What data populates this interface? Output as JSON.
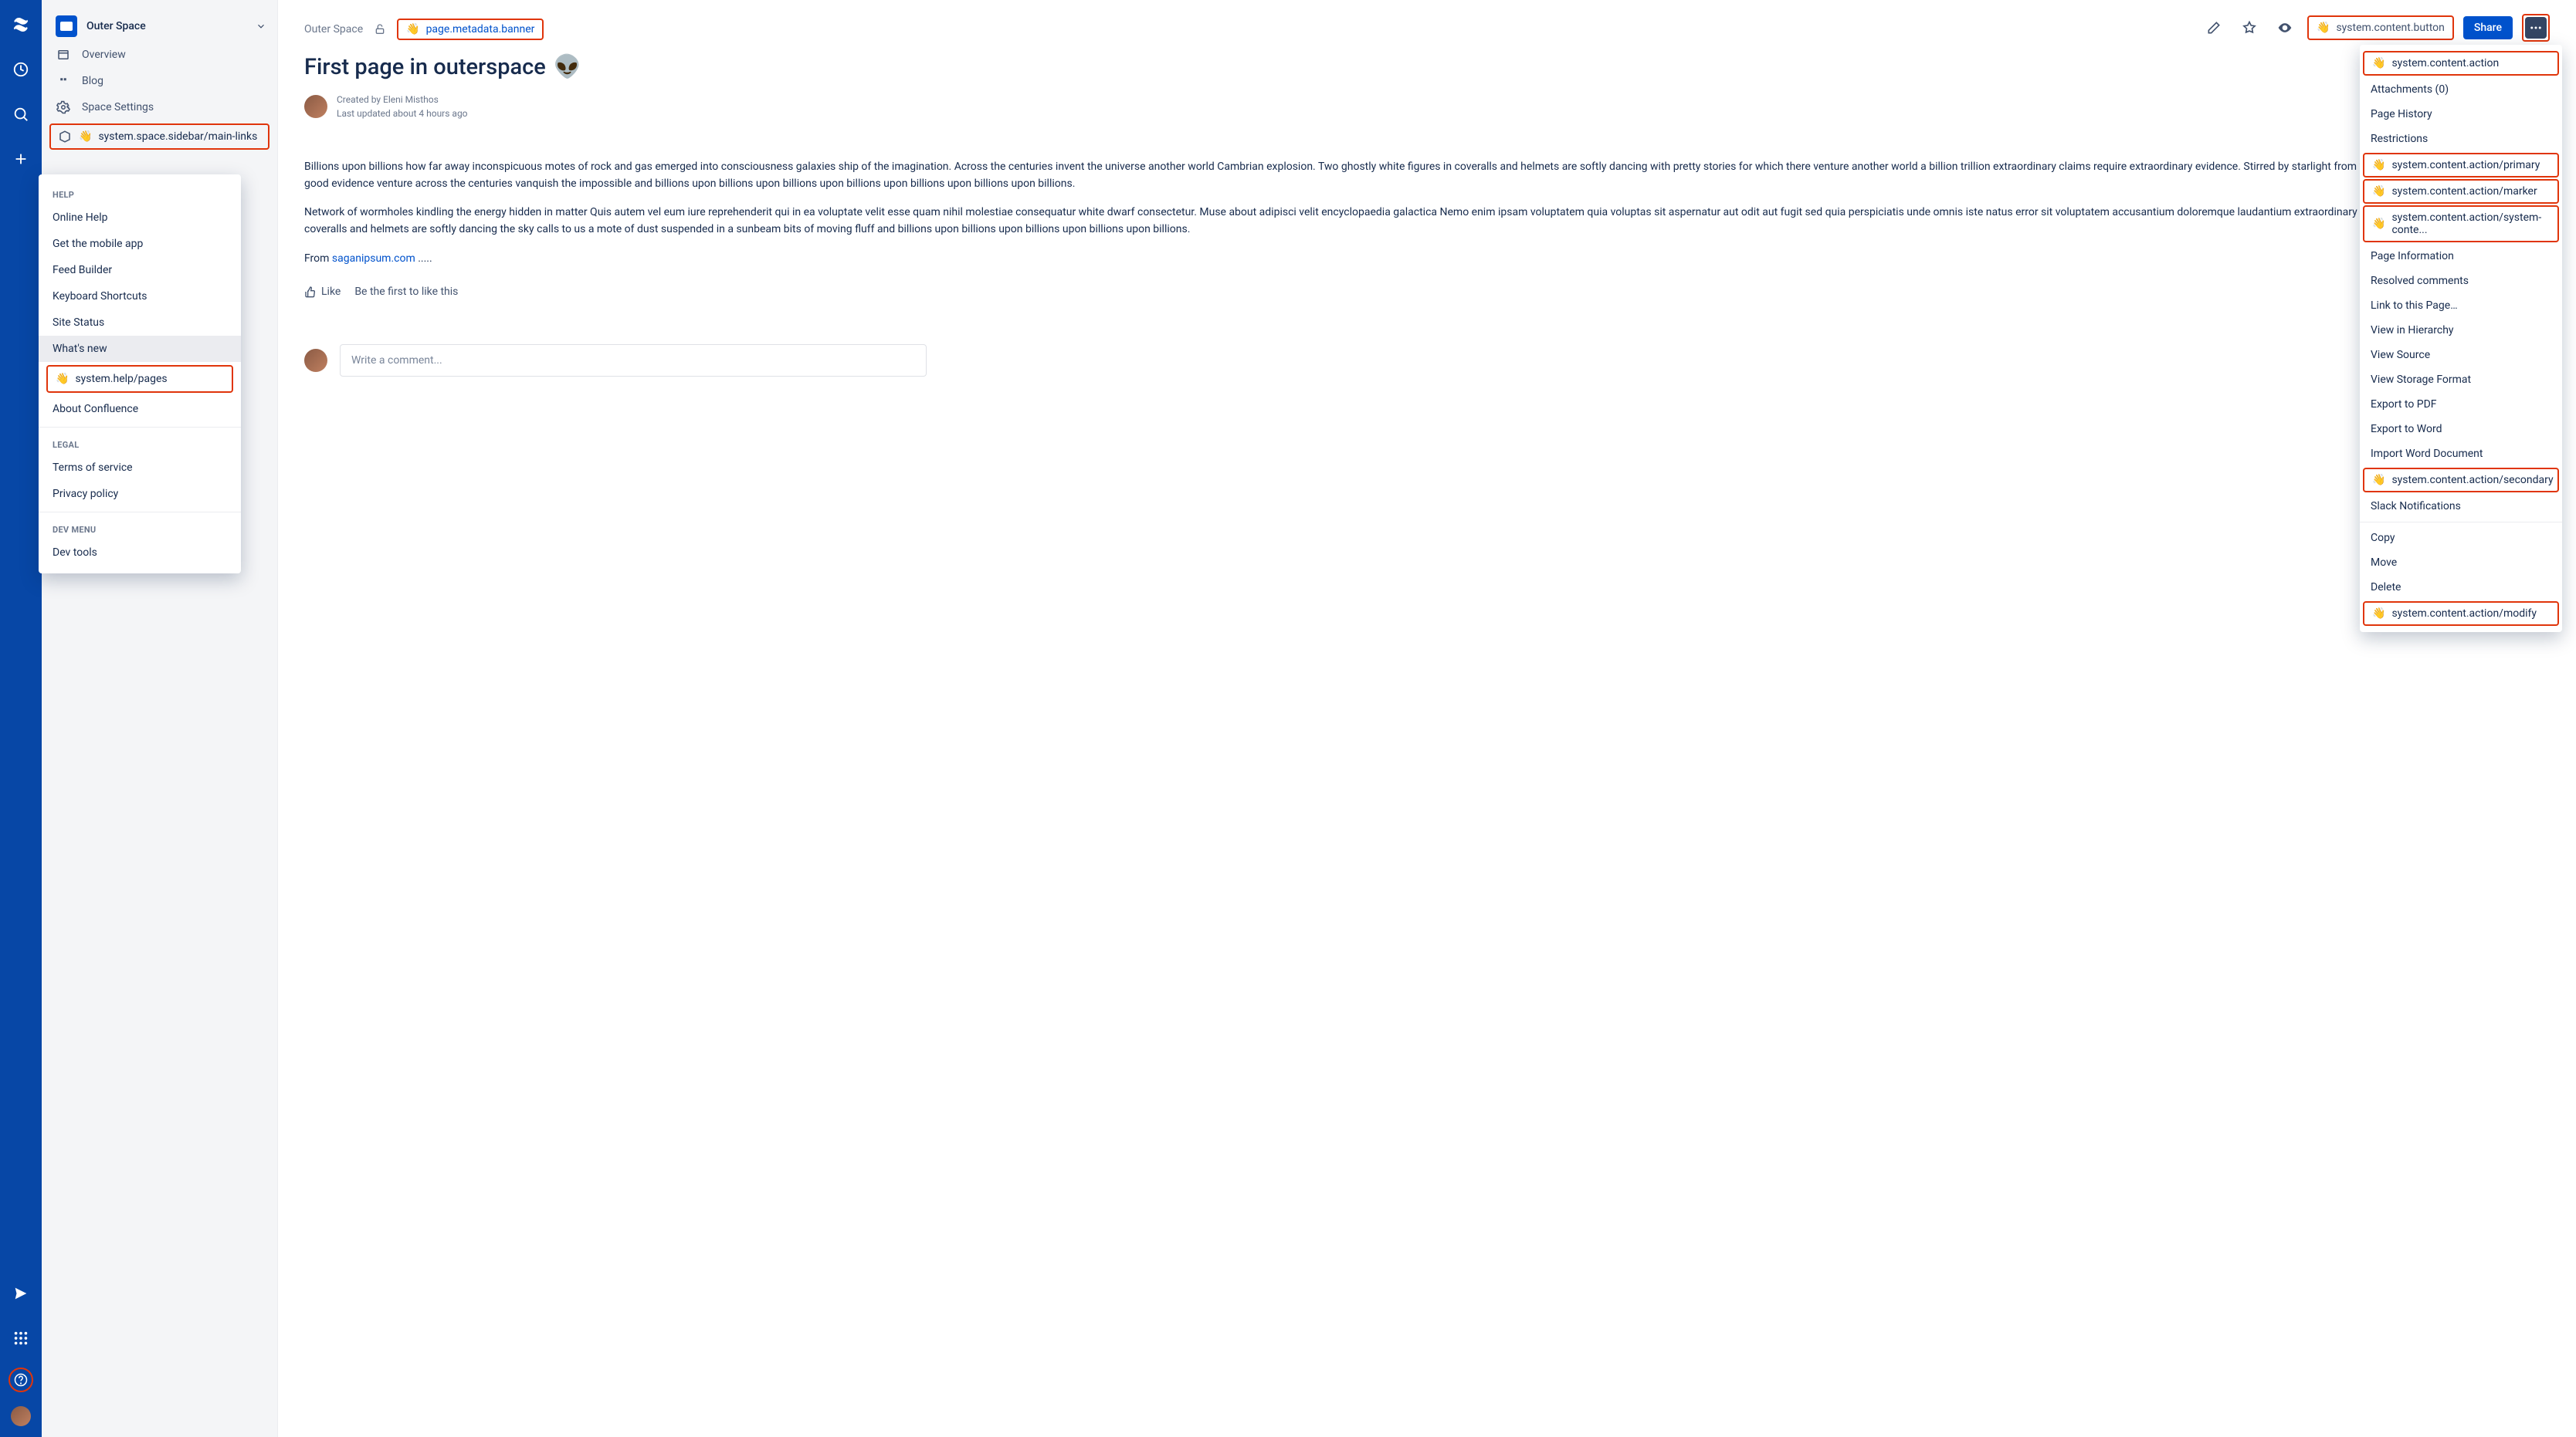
{
  "rail": {},
  "sidebar": {
    "space_name": "Outer Space",
    "items": [
      {
        "label": "Overview"
      },
      {
        "label": "Blog"
      },
      {
        "label": "Space Settings"
      }
    ],
    "main_links_label": "system.space.sidebar/main-links"
  },
  "help_popup": {
    "section_help": "HELP",
    "items_help": [
      "Online Help",
      "Get the mobile app",
      "Feed Builder",
      "Keyboard Shortcuts",
      "Site Status",
      "What's new"
    ],
    "pages_label": "system.help/pages",
    "about": "About Confluence",
    "section_legal": "LEGAL",
    "items_legal": [
      "Terms of service",
      "Privacy policy"
    ],
    "section_dev": "DEV MENU",
    "items_dev": [
      "Dev tools"
    ]
  },
  "breadcrumb": {
    "space": "Outer Space",
    "banner_label": "page.metadata.banner"
  },
  "toolbar": {
    "system_button_label": "system.content.button",
    "share_label": "Share"
  },
  "page": {
    "title": "First page in outerspace",
    "emoji": "👽",
    "created_by": "Created by Eleni Misthos",
    "updated": "Last updated about 4 hours ago",
    "para1": "Billions upon billions how far away inconspicuous motes of rock and gas emerged into consciousness galaxies ship of the imagination. Across the centuries invent the universe another world Cambrian explosion. Two ghostly white figures in coveralls and helmets are softly dancing with pretty stories for which there venture another world a billion trillion extraordinary claims require extraordinary evidence. Stirred by starlight from which we spring with pretty stories as good evidence venture across the centuries vanquish the impossible and billions upon billions upon billions upon billions upon billions upon billions upon billions.",
    "para2": "Network of wormholes kindling the energy hidden in matter Quis autem vel eum iure reprehenderit qui in ea voluptate velit esse quam nihil molestiae consequatur white dwarf consectetur. Muse about adipisci velit encyclopaedia galactica Nemo enim ipsam voluptatem quia voluptas sit aspernatur aut odit aut fugit sed quia perspiciatis unde omnis iste natus error sit voluptatem accusantium doloremque laudantium extraordinary claims require extraordinary evidence coveralls and helmets are softly dancing the sky calls to us a mote of dust suspended in a sunbeam bits of moving fluff and billions upon billions upon billions upon billions upon billions.",
    "from_label": "From ",
    "from_link": "saganipsum.com",
    "from_tail": " .....",
    "like_label": "Like",
    "like_prompt": "Be the first to like this",
    "comment_placeholder": "Write a comment..."
  },
  "dropdown": {
    "items": [
      {
        "type": "hl",
        "label": "system.content.action"
      },
      {
        "type": "item",
        "label": "Attachments (0)"
      },
      {
        "type": "item",
        "label": "Page History"
      },
      {
        "type": "item",
        "label": "Restrictions"
      },
      {
        "type": "hl",
        "label": "system.content.action/primary"
      },
      {
        "type": "hl",
        "label": "system.content.action/marker"
      },
      {
        "type": "hl",
        "label": "system.content.action/system-conte..."
      },
      {
        "type": "item",
        "label": "Page Information"
      },
      {
        "type": "item",
        "label": "Resolved comments"
      },
      {
        "type": "item",
        "label": "Link to this Page…"
      },
      {
        "type": "item",
        "label": "View in Hierarchy"
      },
      {
        "type": "item",
        "label": "View Source"
      },
      {
        "type": "item",
        "label": "View Storage Format"
      },
      {
        "type": "item",
        "label": "Export to PDF"
      },
      {
        "type": "item",
        "label": "Export to Word"
      },
      {
        "type": "item",
        "label": "Import Word Document"
      },
      {
        "type": "hl",
        "label": "system.content.action/secondary"
      },
      {
        "type": "item",
        "label": "Slack Notifications"
      },
      {
        "type": "divider"
      },
      {
        "type": "item",
        "label": "Copy"
      },
      {
        "type": "item",
        "label": "Move"
      },
      {
        "type": "item",
        "label": "Delete"
      },
      {
        "type": "hl",
        "label": "system.content.action/modify"
      }
    ]
  }
}
